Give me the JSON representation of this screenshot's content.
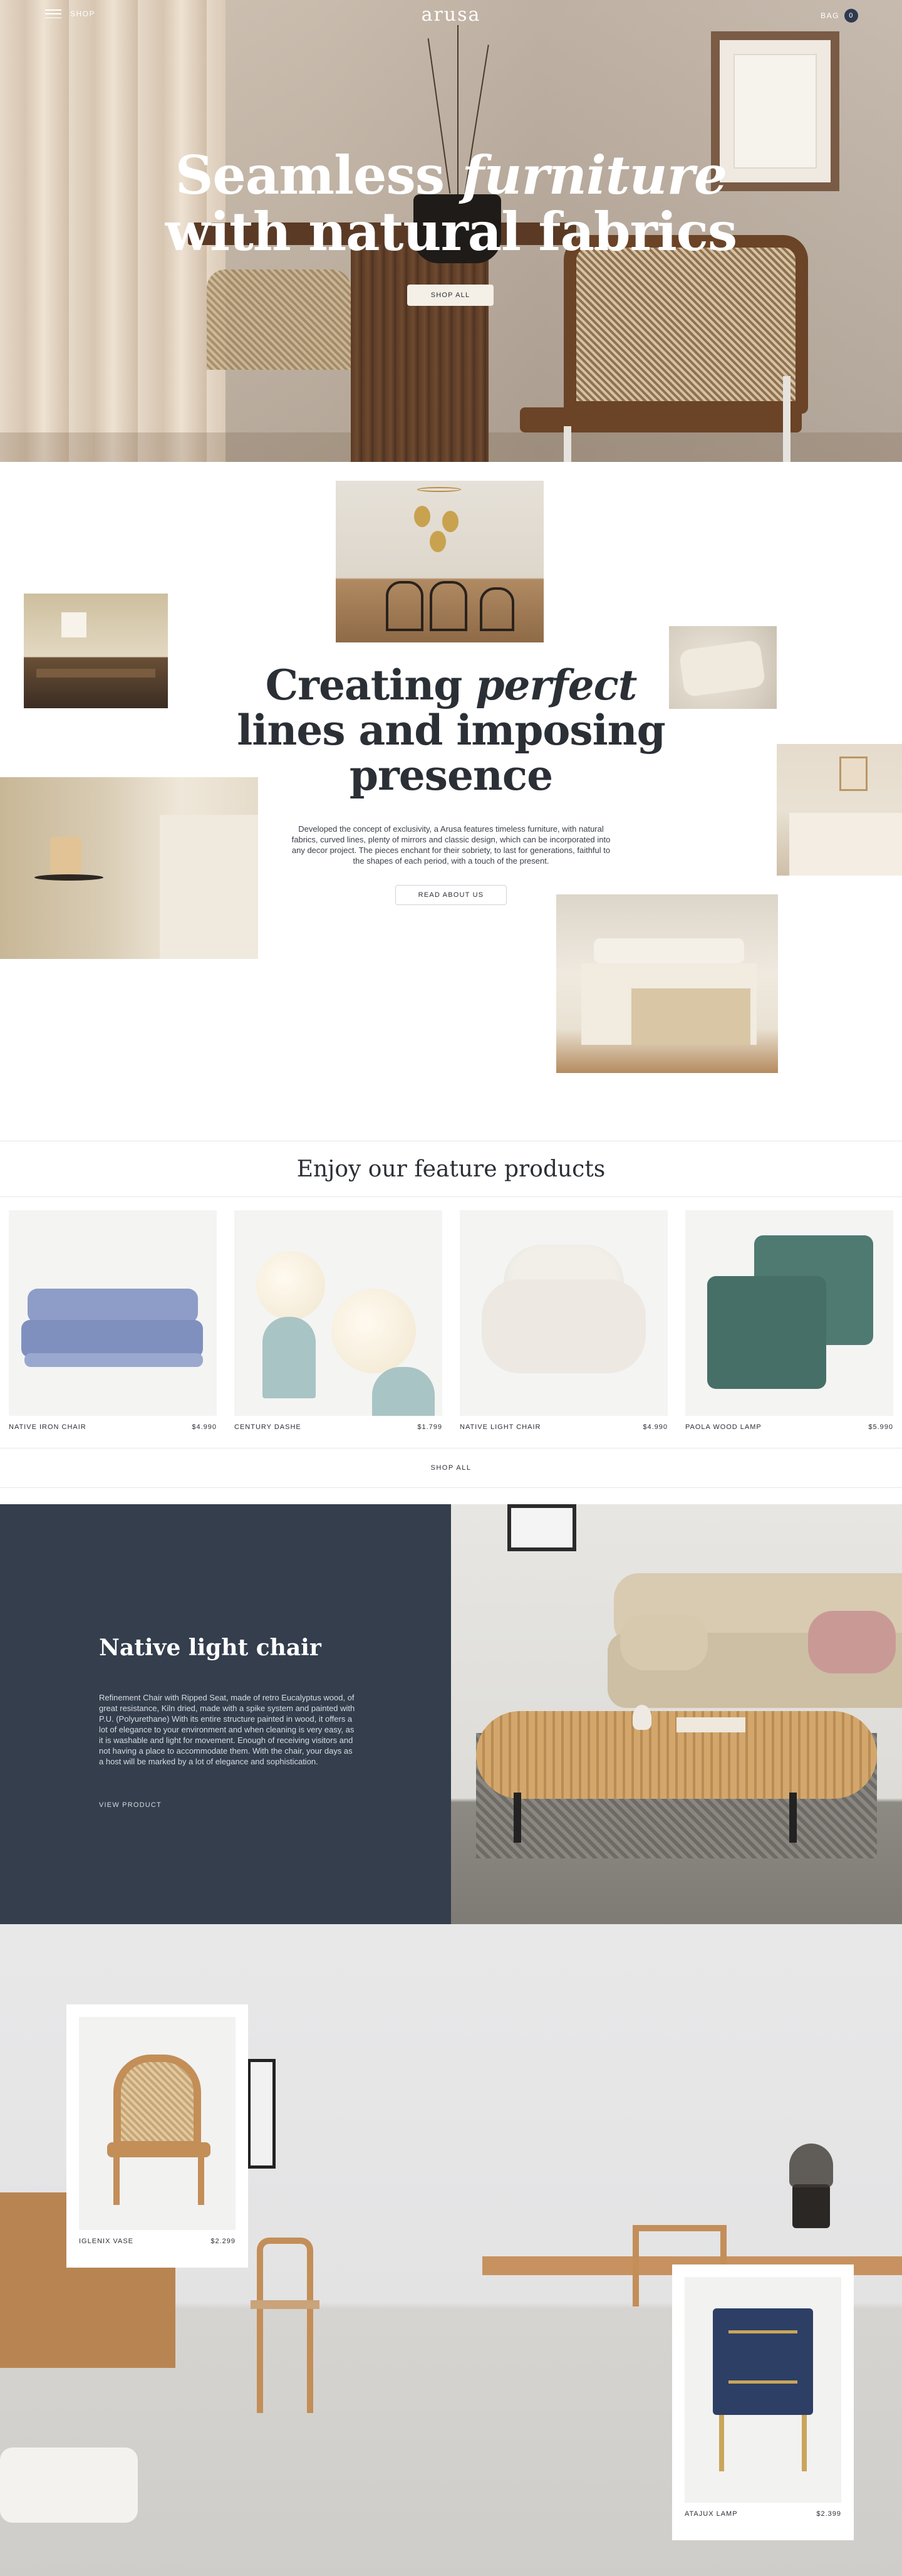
{
  "nav": {
    "menu_label": "SHOP",
    "logo": "arusa",
    "bag_label": "BAG",
    "bag_count": "0"
  },
  "hero": {
    "title_line1_plain": "Seamless ",
    "title_line1_italic": "furniture",
    "title_line2": "with natural fabrics",
    "cta": "SHOP ALL"
  },
  "intro": {
    "title_line1_plain": "Creating ",
    "title_line1_italic": "perfect",
    "title_line2": "lines and imposing",
    "title_line3": "presence",
    "body": "Developed the concept of exclusivity, a Arusa features timeless furniture, with natural fabrics, curved lines, plenty of mirrors and classic design, which can be incorporated into any decor project. The pieces enchant for their sobriety, to last for generations, faithful to the shapes of each period, with a touch of the present.",
    "cta": "READ ABOUT US"
  },
  "featured": {
    "heading": "Enjoy our feature products",
    "products": [
      {
        "name": "NATIVE IRON CHAIR",
        "price": "$4.990"
      },
      {
        "name": "CENTURY DASHE",
        "price": "$1.799"
      },
      {
        "name": "NATIVE LIGHT CHAIR",
        "price": "$4.990"
      },
      {
        "name": "PAOLA WOOD LAMP",
        "price": "$5.990"
      }
    ],
    "shop_all": "SHOP ALL"
  },
  "spotlight": {
    "title": "Native light chair",
    "body": "Refinement Chair with Ripped Seat, made of retro Eucalyptus wood, of great resistance, Kiln dried, made with a spike system and painted with P.U. (Polyurethane) With its entire structure painted in wood, it offers a lot of elegance to your environment and when cleaning is very easy, as it is washable and light for movement. Enough of receiving visitors and not having a place to accommodate them. With the chair, your days as a host will be marked by a lot of elegance and sophistication.",
    "link": "VIEW PRODUCT"
  },
  "room": {
    "cards": [
      {
        "name": "IGLENIX VASE",
        "price": "$2.299"
      },
      {
        "name": "ATAJUX LAMP",
        "price": "$2.399"
      }
    ]
  },
  "colors": {
    "navy": "#343e4d",
    "cream": "#f4efe7",
    "text": "#2b2f36",
    "badge": "#2f3a4f"
  }
}
